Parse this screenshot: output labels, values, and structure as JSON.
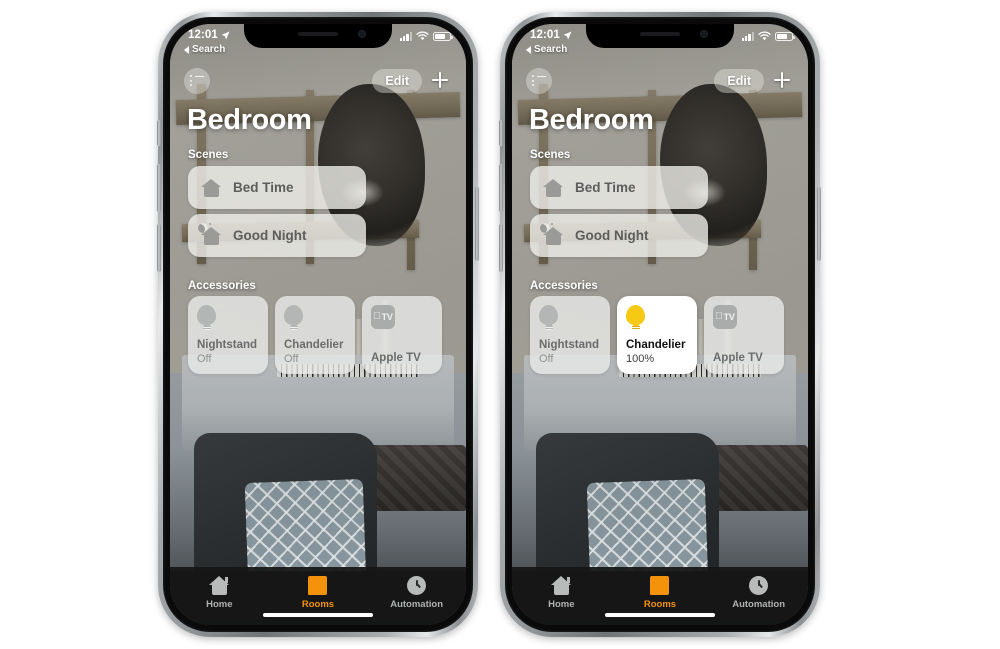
{
  "status_bar": {
    "time": "12:01",
    "location_icon": "location-arrow-icon",
    "back_label": "Search",
    "cellular_icon": "cellular-bars-icon",
    "wifi_icon": "wifi-icon",
    "battery_icon": "battery-icon"
  },
  "toolbar": {
    "list_icon": "list-icon",
    "edit_label": "Edit",
    "add_icon": "plus-icon"
  },
  "header": {
    "room_title": "Bedroom"
  },
  "sections": {
    "scenes_label": "Scenes",
    "accessories_label": "Accessories"
  },
  "scenes": [
    {
      "name": "Bed Time",
      "icon": "house-icon"
    },
    {
      "name": "Good Night",
      "icon": "moon-house-icon"
    }
  ],
  "accessories_left": [
    {
      "name": "Nightstand",
      "status": "Off",
      "icon": "lightbulb-icon",
      "active": false
    },
    {
      "name": "Chandelier",
      "status": "Off",
      "icon": "lightbulb-icon",
      "active": false
    },
    {
      "name": "Apple TV",
      "status": "",
      "icon": "apple-tv-icon",
      "active": false
    }
  ],
  "accessories_right": [
    {
      "name": "Nightstand",
      "status": "Off",
      "icon": "lightbulb-icon",
      "active": false
    },
    {
      "name": "Chandelier",
      "status": "100%",
      "icon": "lightbulb-icon",
      "active": true
    },
    {
      "name": "Apple TV",
      "status": "",
      "icon": "apple-tv-icon",
      "active": false
    }
  ],
  "tabs": [
    {
      "label": "Home",
      "icon": "home-icon",
      "active": false
    },
    {
      "label": "Rooms",
      "icon": "rooms-icon",
      "active": true
    },
    {
      "label": "Automation",
      "icon": "clock-icon",
      "active": false
    }
  ],
  "colors": {
    "accent_orange": "#F5920B",
    "bulb_on_yellow": "#F6C914",
    "tabbar_background": "#161616",
    "card_inactive": "rgba(233,234,233,0.80)",
    "card_active": "#FFFFFF"
  }
}
